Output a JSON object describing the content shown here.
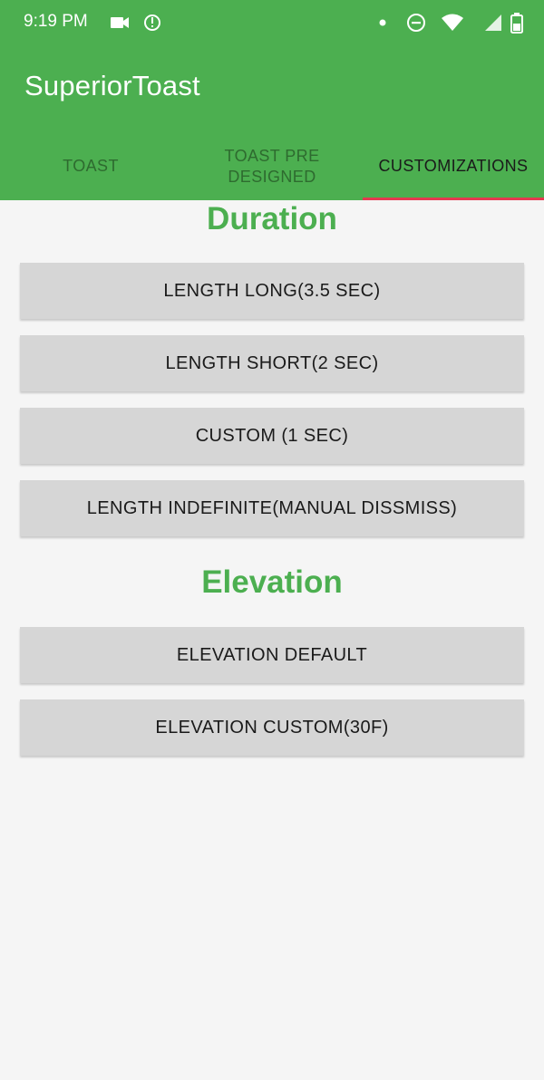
{
  "status_bar": {
    "time": "9:19 PM",
    "icons": [
      "video-icon",
      "update-icon",
      "dot-icon",
      "dnd-icon",
      "wifi-icon",
      "signal-icon",
      "battery-icon"
    ]
  },
  "app": {
    "title": "SuperiorToast",
    "colors": {
      "primary": "#4caf50",
      "tab_indicator": "#e53950",
      "button": "#d6d6d6",
      "background": "#f5f5f5"
    }
  },
  "tabs": [
    {
      "label": "TOAST",
      "active": false
    },
    {
      "label": "TOAST PRE DESIGNED",
      "active": false
    },
    {
      "label": "CUSTOMIZATIONS",
      "active": true
    }
  ],
  "sections": {
    "duration": {
      "title": "Duration",
      "buttons": [
        "LENGTH LONG(3.5 SEC)",
        "LENGTH SHORT(2 SEC)",
        "CUSTOM (1 SEC)",
        "LENGTH INDEFINITE(MANUAL DISSMISS)"
      ]
    },
    "elevation": {
      "title": "Elevation",
      "buttons": [
        "ELEVATION DEFAULT",
        "ELEVATION CUSTOM(30F)"
      ]
    }
  }
}
